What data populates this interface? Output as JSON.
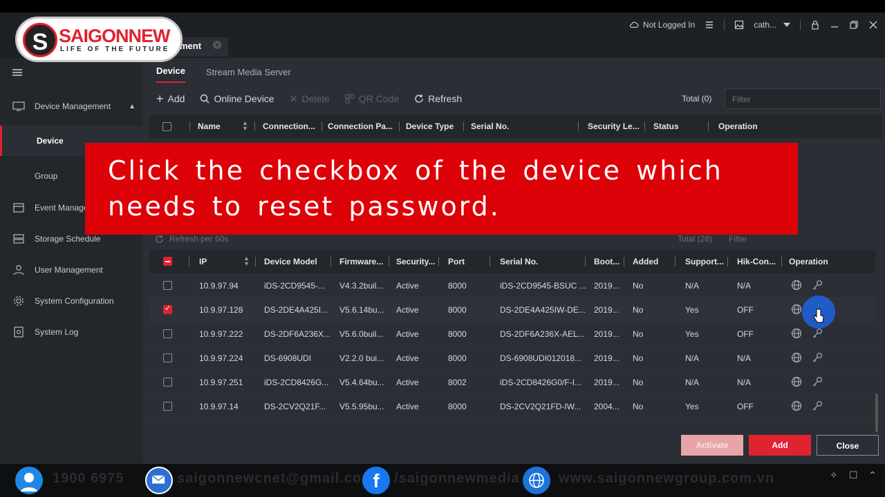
{
  "titlebar": {
    "login_status": "Not Logged In",
    "user": "cath...",
    "icons": [
      "cloud-icon",
      "list-icon",
      "image-icon",
      "dropdown-arrow-icon",
      "lock-icon",
      "minimize-icon",
      "restore-icon",
      "close-icon"
    ]
  },
  "app_tab": {
    "label": "ment"
  },
  "logo": {
    "letter": "S",
    "name": "SAIGONNEW",
    "tagline": "LIFE OF THE FUTURE"
  },
  "sidebar": {
    "items": [
      {
        "label": "Device Management",
        "arrow": "▲"
      },
      {
        "label": "Device"
      },
      {
        "label": "Group"
      },
      {
        "label": "Event Manage"
      },
      {
        "label": "Storage Schedule"
      },
      {
        "label": "User Management"
      },
      {
        "label": "System Configuration"
      },
      {
        "label": "System Log"
      }
    ]
  },
  "subtabs": {
    "device": "Device",
    "stream": "Stream Media Server"
  },
  "toolbar": {
    "add": "Add",
    "online_device": "Online Device",
    "delete": "Delete",
    "qr_code": "QR Code",
    "refresh": "Refresh",
    "total": "Total (0)",
    "filter_placeholder": "Filter"
  },
  "table1": {
    "headers": [
      "Name",
      "Connection...",
      "Connection Pa...",
      "Device Type",
      "Serial No.",
      "Security Le...",
      "Status",
      "Operation"
    ]
  },
  "banner": {
    "text": "Click the checkbox of the device which needs to reset password."
  },
  "dialog": {
    "refresh_label": "Refresh per 60s",
    "total": "Total (28)",
    "filter_placeholder": "Filter",
    "headers": [
      "IP",
      "Device Model",
      "Firmware...",
      "Security...",
      "Port",
      "Serial No.",
      "Boot...",
      "Added",
      "Support...",
      "Hik-Con...",
      "Operation"
    ],
    "rows": [
      {
        "ip": "10.9.97.94",
        "model": "iDS-2CD9545-...",
        "firmware": "V4.3.2buil...",
        "security": "Active",
        "port": "8000",
        "serial": "iDS-2CD9545-BSUC ...",
        "boot": "2019...",
        "added": "No",
        "support": "N/A",
        "hik": "N/A",
        "checked": false
      },
      {
        "ip": "10.9.97.128",
        "model": "DS-2DE4A425I...",
        "firmware": "V5.6.14bu...",
        "security": "Active",
        "port": "8000",
        "serial": "DS-2DE4A425IW-DE...",
        "boot": "2019...",
        "added": "No",
        "support": "Yes",
        "hik": "OFF",
        "checked": true
      },
      {
        "ip": "10.9.97.222",
        "model": "DS-2DF6A236X...",
        "firmware": "V5.6.0buil...",
        "security": "Active",
        "port": "8000",
        "serial": "DS-2DF6A236X-AEL...",
        "boot": "2019...",
        "added": "No",
        "support": "Yes",
        "hik": "OFF",
        "checked": false
      },
      {
        "ip": "10.9.97.224",
        "model": "DS-6908UDI",
        "firmware": "V2.2.0 bui...",
        "security": "Active",
        "port": "8000",
        "serial": "DS-6908UDI012018...",
        "boot": "2019...",
        "added": "No",
        "support": "N/A",
        "hik": "N/A",
        "checked": false
      },
      {
        "ip": "10.9.97.251",
        "model": "iDS-2CD8426G...",
        "firmware": "V5.4.64bu...",
        "security": "Active",
        "port": "8002",
        "serial": "iDS-2CD8426G0/F-I...",
        "boot": "2019...",
        "added": "No",
        "support": "N/A",
        "hik": "N/A",
        "checked": false
      },
      {
        "ip": "10.9.97.14",
        "model": "DS-2CV2Q21F...",
        "firmware": "V5.5.95bu...",
        "security": "Active",
        "port": "8000",
        "serial": "DS-2CV2Q21FD-IW...",
        "boot": "2004...",
        "added": "No",
        "support": "Yes",
        "hik": "OFF",
        "checked": false
      }
    ],
    "buttons": {
      "activate": "Activate",
      "add": "Add",
      "close": "Close"
    }
  },
  "footer": {
    "phone": "1900 6975",
    "email": "saigonnewcnet@gmail.com",
    "facebook": "/saigonnewmedia",
    "website": "www.saigonnewgroup.com.vn"
  },
  "colors": {
    "accent": "#e1232f",
    "banner": "#dd0208",
    "background": "#2b2f35",
    "sidebar": "#23272c"
  }
}
